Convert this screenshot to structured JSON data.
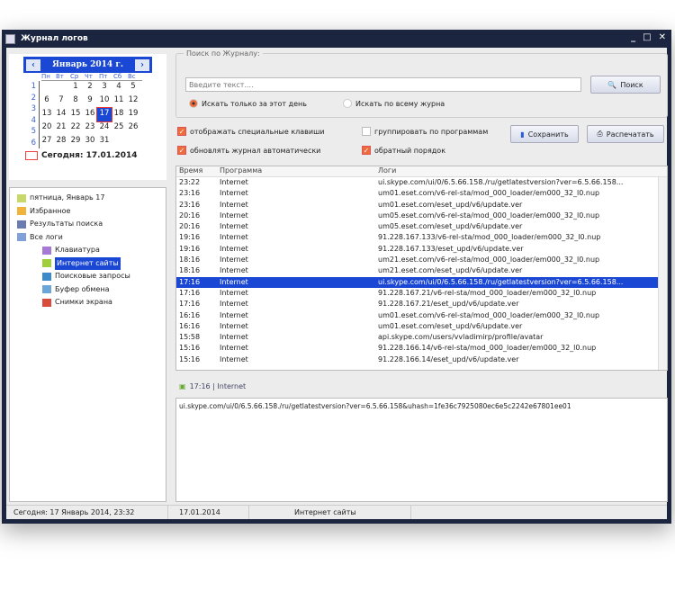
{
  "window": {
    "title": "Журнал логов"
  },
  "calendar": {
    "month_label": "Январь 2014 г.",
    "weekdays": [
      "Пн",
      "Вт",
      "Ср",
      "Чт",
      "Пт",
      "Сб",
      "Вс"
    ],
    "week_numbers": [
      "1",
      "2",
      "3",
      "4",
      "5",
      "6"
    ],
    "days": [
      "",
      "",
      "1",
      "2",
      "3",
      "4",
      "5",
      "6",
      "7",
      "8",
      "9",
      "10",
      "11",
      "12",
      "13",
      "14",
      "15",
      "16",
      "17",
      "18",
      "19",
      "20",
      "21",
      "22",
      "23",
      "24",
      "25",
      "26",
      "27",
      "28",
      "29",
      "30",
      "31"
    ],
    "selected_day": "17",
    "today_label": "Сегодня: 17.01.2014"
  },
  "tree": {
    "items": [
      {
        "label": "пятница, Январь 17",
        "level": 0,
        "color": "#c9d86a"
      },
      {
        "label": "Избранное",
        "level": 0,
        "color": "#f2b33a"
      },
      {
        "label": "Результаты поиска",
        "level": 0,
        "color": "#6a7bb0"
      },
      {
        "label": "Все логи",
        "level": 0,
        "color": "#7fa0d8"
      },
      {
        "label": "Клавиатура",
        "level": 1,
        "color": "#a779d6"
      },
      {
        "label": "Интернет сайты",
        "level": 1,
        "color": "#9fcf3a",
        "selected": true
      },
      {
        "label": "Поисковые запросы",
        "level": 1,
        "color": "#3d8ac9"
      },
      {
        "label": "Буфер обмена",
        "level": 1,
        "color": "#6aa6d8"
      },
      {
        "label": "Снимки экрана",
        "level": 1,
        "color": "#d84a3a"
      }
    ]
  },
  "search": {
    "legend": "Поиск по Журналу:",
    "placeholder": "Введите текст....",
    "button": "Поиск",
    "radio_day": "Искать только за этот день",
    "radio_all": "Искать по всему журна"
  },
  "options": {
    "show_special_keys": "отображать специальные клавиши",
    "auto_update": "обновлять журнал автоматически",
    "group_by_program": "группировать по программам",
    "reverse_order": "обратный порядок",
    "save": "Сохранить",
    "print": "Распечатать"
  },
  "table": {
    "headers": [
      "Время",
      "Программа",
      "Логи"
    ],
    "rows": [
      [
        "23:22",
        "Internet",
        "ui.skype.com/ui/0/6.5.66.158./ru/getlatestversion?ver=6.5.66.158..."
      ],
      [
        "23:16",
        "Internet",
        "um01.eset.com/v6-rel-sta/mod_000_loader/em000_32_l0.nup"
      ],
      [
        "23:16",
        "Internet",
        "um01.eset.com/eset_upd/v6/update.ver"
      ],
      [
        "20:16",
        "Internet",
        "um05.eset.com/v6-rel-sta/mod_000_loader/em000_32_l0.nup"
      ],
      [
        "20:16",
        "Internet",
        "um05.eset.com/eset_upd/v6/update.ver"
      ],
      [
        "19:16",
        "Internet",
        "91.228.167.133/v6-rel-sta/mod_000_loader/em000_32_l0.nup"
      ],
      [
        "19:16",
        "Internet",
        "91.228.167.133/eset_upd/v6/update.ver"
      ],
      [
        "18:16",
        "Internet",
        "um21.eset.com/v6-rel-sta/mod_000_loader/em000_32_l0.nup"
      ],
      [
        "18:16",
        "Internet",
        "um21.eset.com/eset_upd/v6/update.ver"
      ],
      [
        "17:16",
        "Internet",
        "ui.skype.com/ui/0/6.5.66.158./ru/getlatestversion?ver=6.5.66.158..."
      ],
      [
        "17:16",
        "Internet",
        "91.228.167.21/v6-rel-sta/mod_000_loader/em000_32_l0.nup"
      ],
      [
        "17:16",
        "Internet",
        "91.228.167.21/eset_upd/v6/update.ver"
      ],
      [
        "16:16",
        "Internet",
        "um01.eset.com/v6-rel-sta/mod_000_loader/em000_32_l0.nup"
      ],
      [
        "16:16",
        "Internet",
        "um01.eset.com/eset_upd/v6/update.ver"
      ],
      [
        "15:58",
        "Internet",
        "api.skype.com/users/vvladimirp/profile/avatar"
      ],
      [
        "15:16",
        "Internet",
        "91.228.166.14/v6-rel-sta/mod_000_loader/em000_32_l0.nup"
      ],
      [
        "15:16",
        "Internet",
        "91.228.166.14/eset_upd/v6/update.ver"
      ]
    ],
    "selected_index": 9
  },
  "detail": {
    "header": "17:16 | Internet",
    "text": "ui.skype.com/ui/0/6.5.66.158./ru/getlatestversion?ver=6.5.66.158&uhash=1fe36c7925080ec6e5c2242e67801ee01"
  },
  "status": {
    "now": "Сегодня: 17 Январь 2014, 23:32",
    "date": "17.01.2014",
    "section": "Интернет сайты"
  }
}
